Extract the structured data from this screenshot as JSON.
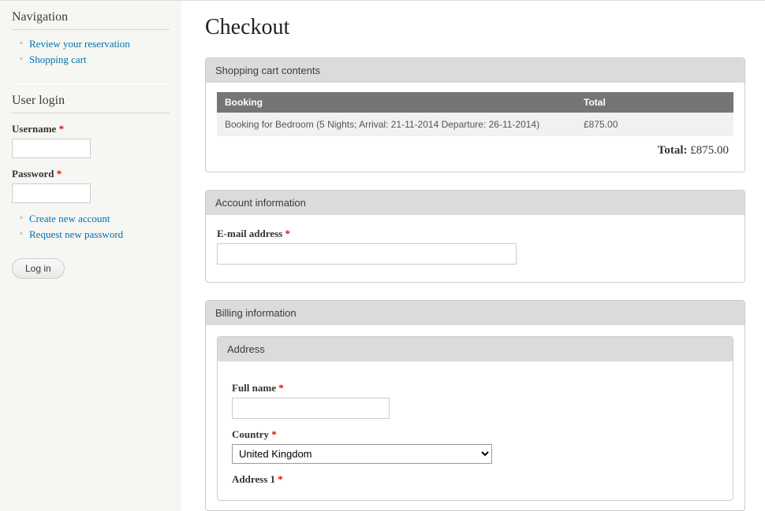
{
  "nav": {
    "title": "Navigation",
    "items": [
      {
        "label": "Review your reservation"
      },
      {
        "label": "Shopping cart"
      }
    ]
  },
  "login": {
    "title": "User login",
    "username_label": "Username",
    "password_label": "Password",
    "links": [
      {
        "label": "Create new account"
      },
      {
        "label": "Request new password"
      }
    ],
    "login_button": "Log in"
  },
  "page": {
    "title": "Checkout"
  },
  "cart": {
    "title": "Shopping cart contents",
    "columns": {
      "booking": "Booking",
      "total": "Total"
    },
    "rows": [
      {
        "booking": "Booking for Bedroom (5 Nights; Arrival: 21-11-2014 Departure: 26-11-2014)",
        "total": "£875.00"
      }
    ],
    "total_label": "Total:",
    "total_value": "£875.00"
  },
  "account": {
    "title": "Account information",
    "email_label": "E-mail address"
  },
  "billing": {
    "title": "Billing information",
    "address_title": "Address",
    "fullname_label": "Full name",
    "country_label": "Country",
    "country_value": "United Kingdom",
    "address1_label": "Address 1"
  }
}
